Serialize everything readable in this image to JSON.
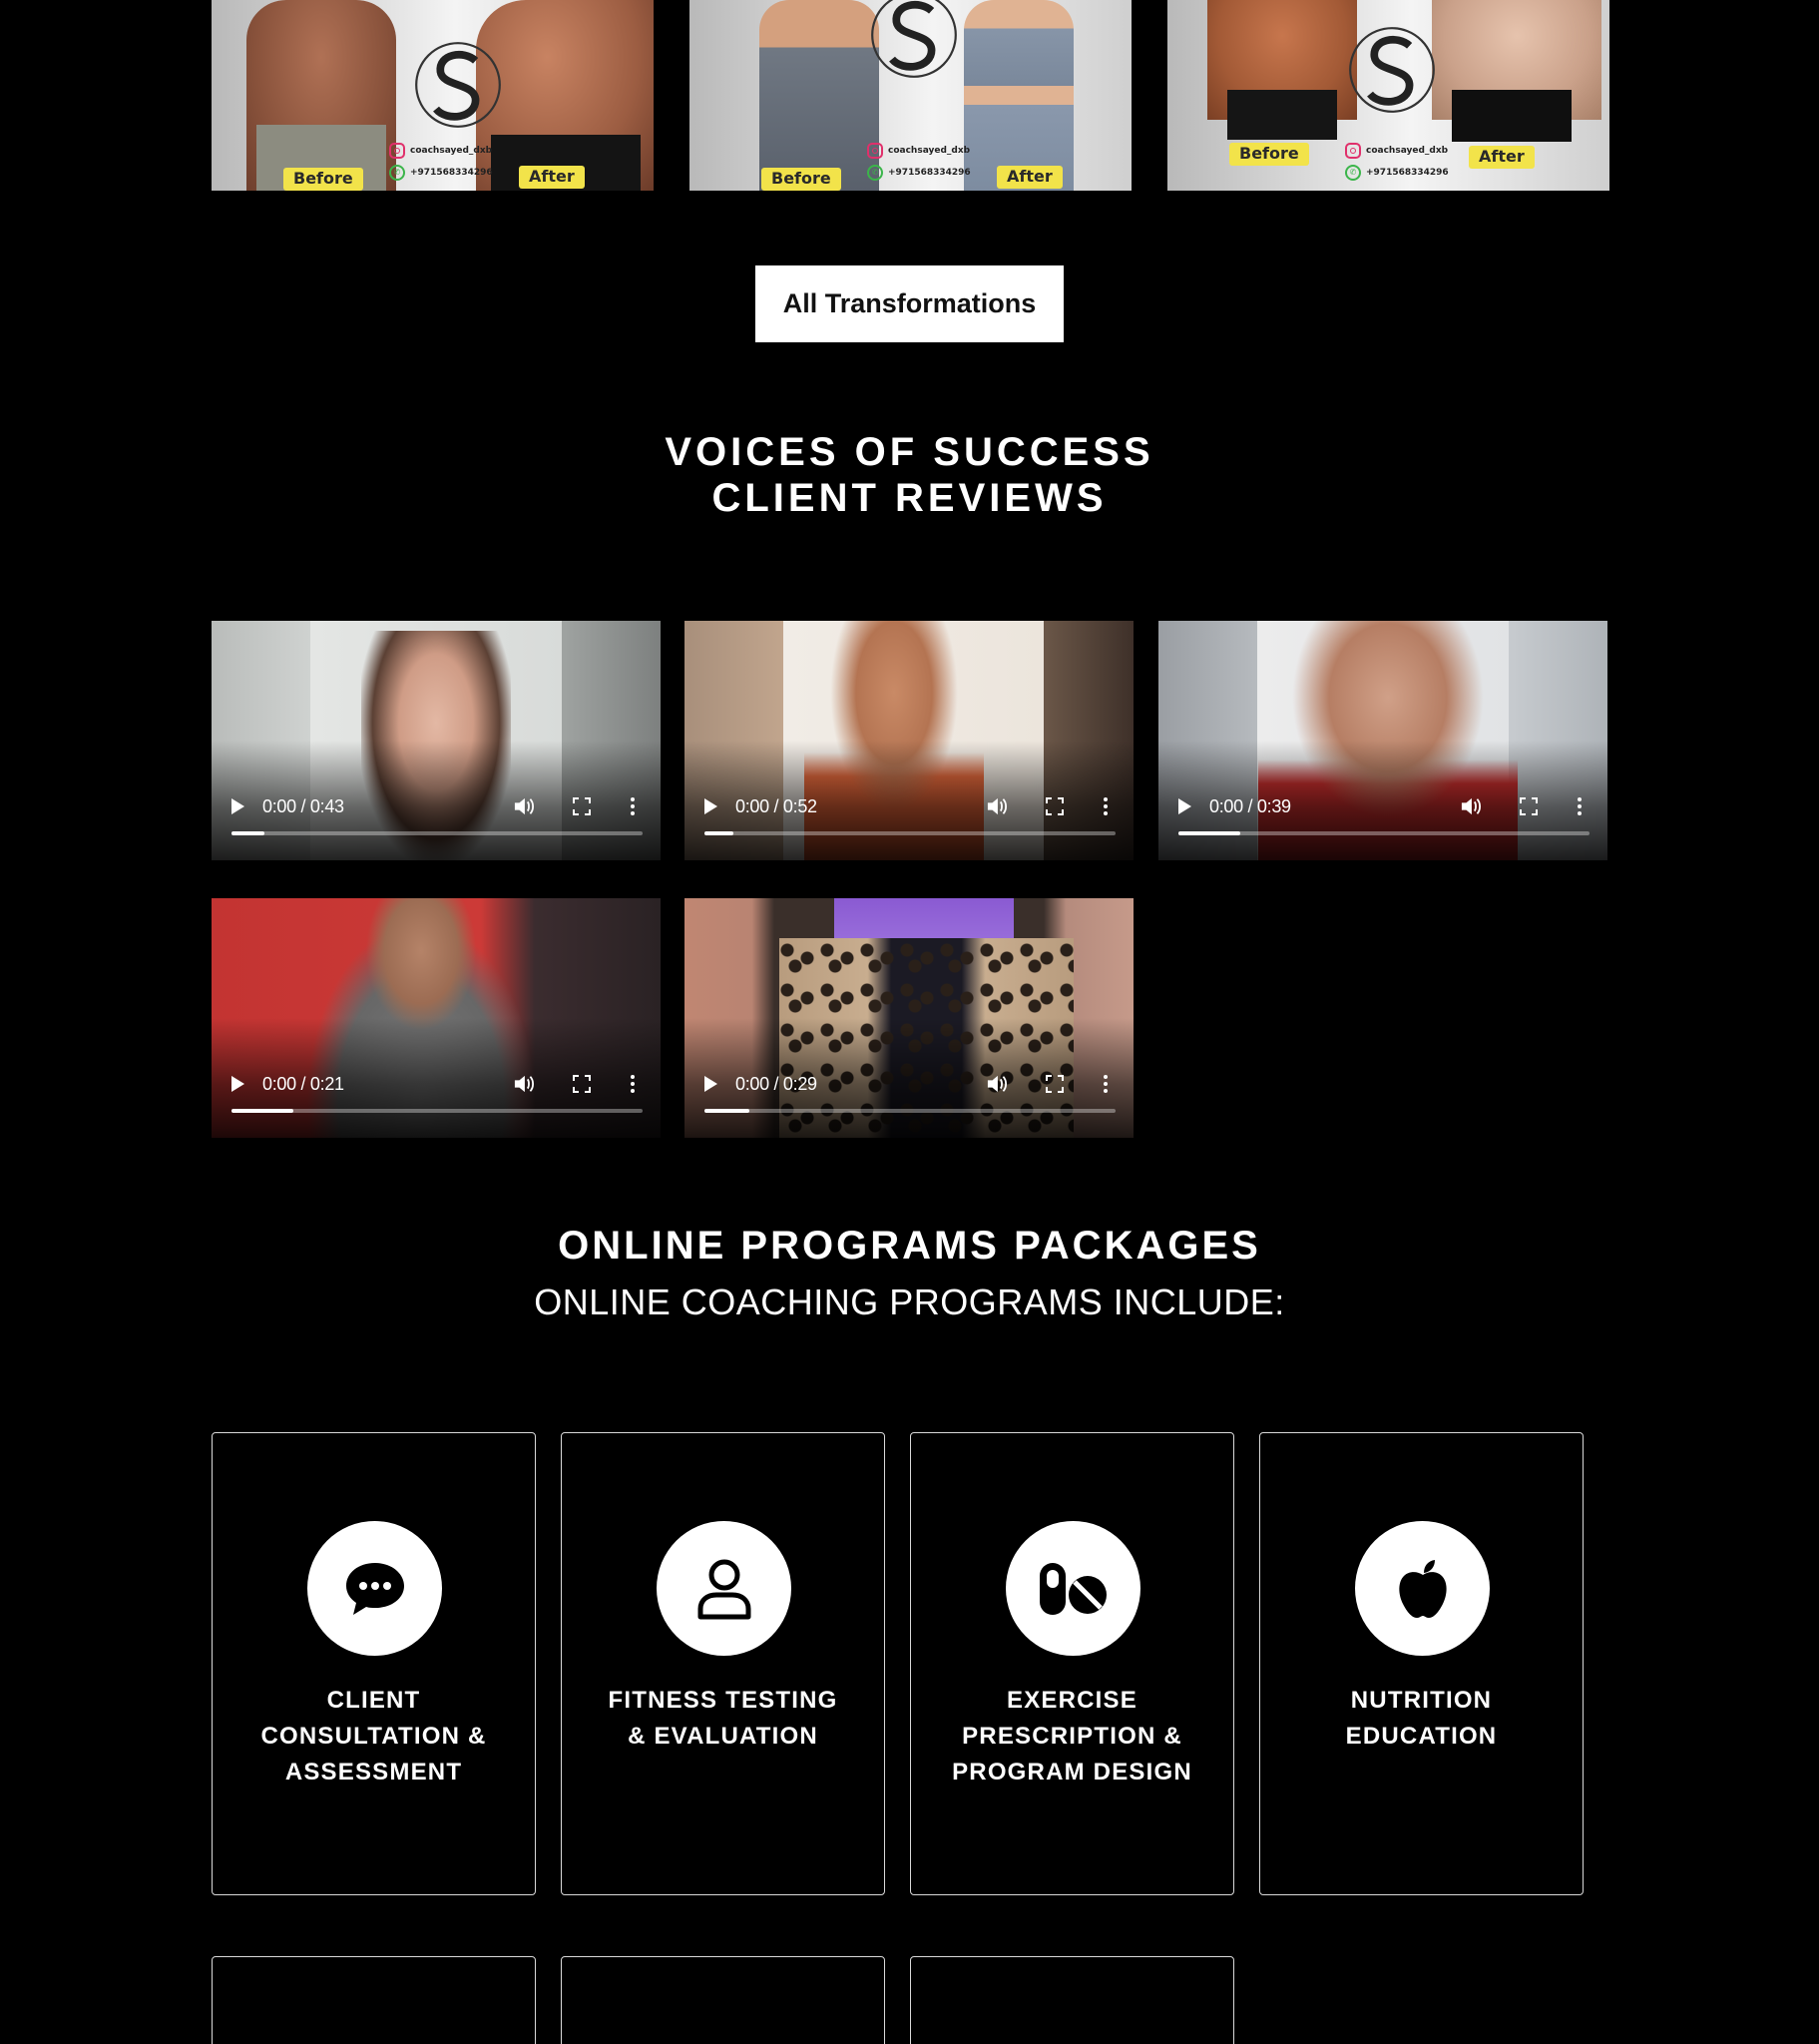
{
  "transformations": [
    {
      "before": "Before",
      "after": "After",
      "instagram": "coachsayed_dxb",
      "phone": "+971568334296"
    },
    {
      "before": "Before",
      "after": "After",
      "instagram": "coachsayed_dxb",
      "phone": "+971568334296"
    },
    {
      "before": "Before",
      "after": "After",
      "instagram": "coachsayed_dxb",
      "phone": "+971568334296"
    }
  ],
  "all_transformations_button": "All Transformations",
  "reviews_heading": {
    "line1": "VOICES OF SUCCESS",
    "line2": "CLIENT REVIEWS"
  },
  "videos": [
    {
      "time": "0:00 / 0:43",
      "progress": 0.08
    },
    {
      "time": "0:00 / 0:52",
      "progress": 0.07
    },
    {
      "time": "0:00 / 0:39",
      "progress": 0.15
    },
    {
      "time": "0:00 / 0:21",
      "progress": 0.15
    },
    {
      "time": "0:00 / 0:29",
      "progress": 0.11
    }
  ],
  "programs_heading": {
    "title": "ONLINE PROGRAMS PACKAGES",
    "subtitle": "ONLINE COACHING PROGRAMS INCLUDE:"
  },
  "programs": [
    {
      "icon": "chat-bubble-icon",
      "line1": "CLIENT",
      "line2": "CONSULTATION &",
      "line3": "ASSESSMENT"
    },
    {
      "icon": "user-icon",
      "line1": "FITNESS TESTING",
      "line2": "& EVALUATION",
      "line3": ""
    },
    {
      "icon": "pills-icon",
      "line1": "EXERCISE",
      "line2": "PRESCRIPTION &",
      "line3": "PROGRAM DESIGN"
    },
    {
      "icon": "apple-icon",
      "line1": "NUTRITION",
      "line2": "EDUCATION",
      "line3": ""
    }
  ],
  "colors": {
    "background": "#000000",
    "badge": "#f2e34a",
    "button_bg": "#ffffff"
  }
}
